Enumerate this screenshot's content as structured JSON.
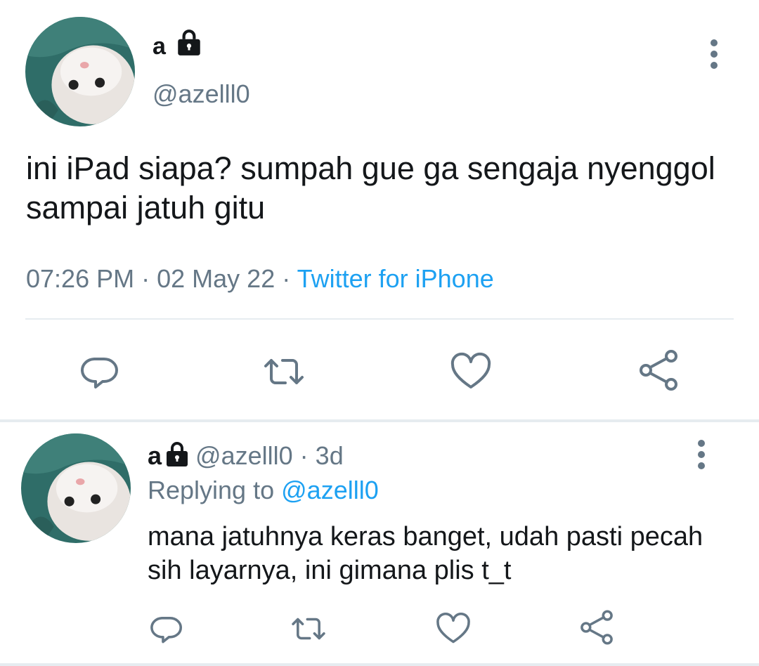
{
  "main_tweet": {
    "display_name": "a",
    "handle": "@azelll0",
    "text": "ini iPad siapa? sumpah gue ga sengaja nyenggol sampai jatuh gitu",
    "time": "07:26 PM",
    "separator": "·",
    "date": "02 May 22",
    "source": "Twitter for iPhone"
  },
  "reply_tweet": {
    "display_name": "a",
    "handle": "@azelll0",
    "separator": "·",
    "age": "3d",
    "replying_label": "Replying to",
    "replying_to": "@azelll0",
    "text": "mana jatuhnya keras banget, udah pasti pecah sih layarnya, ini gimana plis t_t"
  },
  "icons": {
    "protected": "lock-icon",
    "more": "more-vertical-icon",
    "reply": "reply-icon",
    "retweet": "retweet-icon",
    "like": "heart-icon",
    "share": "share-icon"
  },
  "colors": {
    "text": "#14171a",
    "secondary": "#657786",
    "link": "#1da1f2",
    "divider": "#e6ecf0"
  }
}
